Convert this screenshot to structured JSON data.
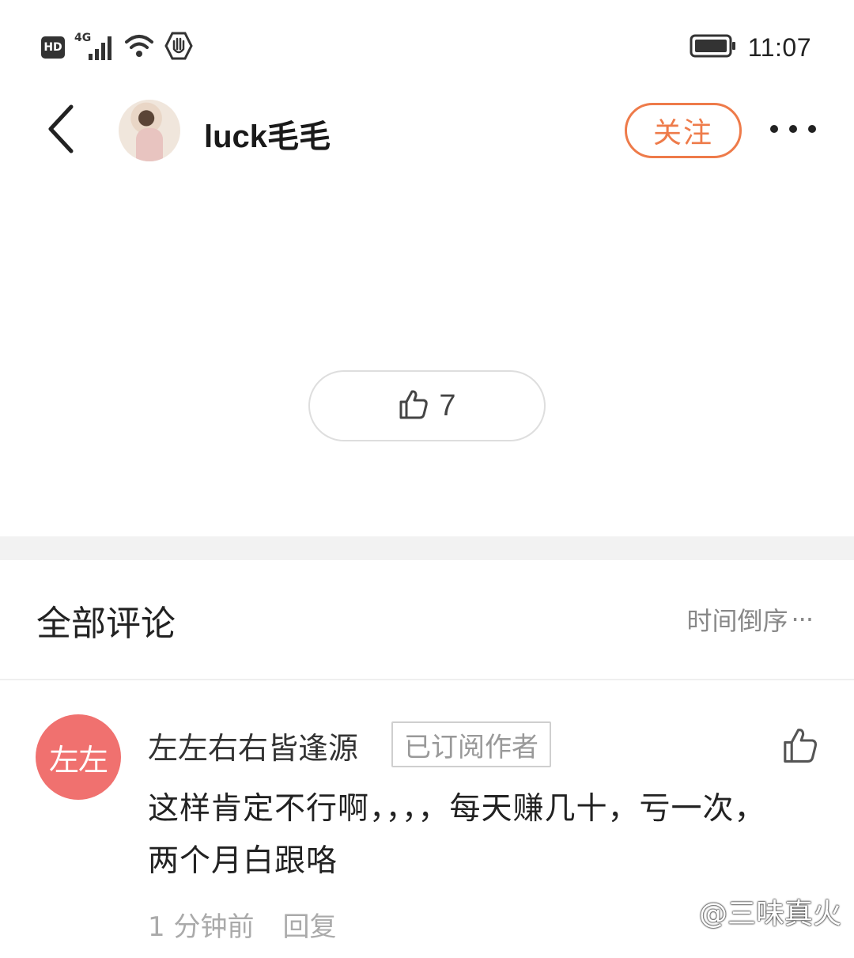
{
  "status_bar": {
    "hd_label": "HD",
    "network_label": "4G",
    "time": "11:07",
    "icons": [
      "hd-icon",
      "signal-icon",
      "wifi-icon",
      "hand-icon",
      "battery-icon"
    ]
  },
  "header": {
    "username": "luck毛毛",
    "follow_label": "关注",
    "icons": [
      "back-icon",
      "more-icon"
    ]
  },
  "post": {
    "like_count": "7",
    "icons": [
      "thumbs-up-icon"
    ]
  },
  "comments": {
    "title": "全部评论",
    "sort_label": "时间倒序",
    "items": [
      {
        "avatar_text": "左左",
        "name": "左左右右皆逢源",
        "badge": "已订阅作者",
        "text": "这样肯定不行啊，，，，每天赚几十，亏一次，两个月白跟咯",
        "time": "1 分钟前",
        "reply_label": "回复"
      }
    ]
  },
  "watermark": {
    "text": "@三味真火"
  },
  "colors": {
    "accent": "#ee7b4a",
    "comment_avatar_bg": "#f0716f",
    "divider": "#f2f2f2"
  }
}
